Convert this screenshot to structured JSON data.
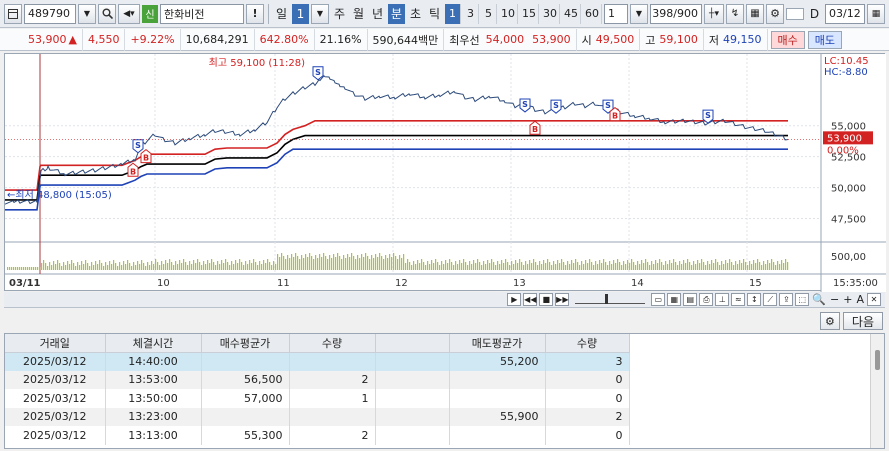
{
  "toolbar": {
    "code": "489790",
    "brand_tag": "신",
    "name": "한화비전",
    "period_day": "일",
    "period_day_num": "1",
    "periods": [
      "주",
      "월",
      "년",
      "분",
      "초",
      "틱"
    ],
    "active_period": "분",
    "minute_options": [
      "1",
      "3",
      "5",
      "10",
      "15",
      "30",
      "45",
      "60"
    ],
    "active_minute": "1",
    "unit_value": "1",
    "count_display": "398/900",
    "d_label": "D",
    "date": "03/12"
  },
  "quote": {
    "price": "53,900",
    "change_arrow": "▲",
    "change": "4,550",
    "change_pct": "+9.22%",
    "volume": "10,684,291",
    "turnover_pct": "642.80%",
    "ratio": "21.16%",
    "amount": "590,644백만",
    "priority_label": "최우선",
    "ask": "54,000",
    "bid": "53,900",
    "open_label": "시",
    "open": "49,500",
    "high_label": "고",
    "high": "59,100",
    "low_label": "저",
    "low": "49,150",
    "buy_label": "매수",
    "sell_label": "매도"
  },
  "chart_data": {
    "type": "line",
    "high_annotation": "최고 59,100 (11:28)",
    "low_annotation": "←최저 48,800 (15:05)",
    "lc_label": "LC:10.45",
    "hc_label": "HC:-8.80",
    "current_price_label": "53,900",
    "current_pct_label": "0.00%",
    "y_ticks": [
      "55,000",
      "52,500",
      "50,000",
      "47,500"
    ],
    "volume_tick": "500,00",
    "x_labels": [
      "03/11",
      "10",
      "11",
      "12",
      "13",
      "14",
      "15"
    ],
    "time_label": "15:35:00",
    "ylim": [
      45600,
      60800
    ],
    "x": [
      0,
      9,
      17,
      25,
      32,
      35,
      36,
      40,
      43,
      60,
      90,
      117,
      130,
      136,
      142,
      150,
      158,
      170,
      185,
      200,
      210,
      222,
      235,
      250,
      262,
      272,
      280,
      288,
      300,
      310,
      315,
      320,
      325,
      330,
      335,
      340,
      348,
      360,
      375,
      390,
      405,
      420,
      435,
      450,
      460,
      470,
      485,
      500,
      510,
      520,
      530,
      540,
      550,
      560,
      570,
      580,
      590,
      600,
      605,
      615,
      630,
      645,
      660,
      680,
      700,
      720,
      740,
      760,
      770,
      783
    ],
    "price": [
      48800,
      48800,
      48900,
      48850,
      48900,
      50800,
      51300,
      51500,
      51600,
      51100,
      51400,
      51900,
      52300,
      53400,
      53800,
      54300,
      53900,
      53600,
      54000,
      54300,
      54600,
      54500,
      54300,
      54700,
      55300,
      56500,
      57200,
      57600,
      58100,
      58400,
      58800,
      59100,
      58900,
      58600,
      58300,
      58100,
      57600,
      57200,
      57400,
      57300,
      57600,
      57300,
      57500,
      57800,
      57300,
      57100,
      57400,
      57000,
      56600,
      56800,
      56300,
      56100,
      56300,
      56500,
      56800,
      56600,
      56800,
      56400,
      56600,
      56100,
      55800,
      55600,
      55300,
      55400,
      55200,
      55400,
      54900,
      54600,
      54300,
      53900
    ],
    "upper_band": [
      49800,
      49800,
      49800,
      49800,
      49800,
      51700,
      51800,
      51800,
      51800,
      51800,
      51800,
      51800,
      52200,
      52500,
      52700,
      52700,
      52700,
      52700,
      52700,
      52700,
      53100,
      53200,
      53200,
      53200,
      53200,
      53600,
      54300,
      54700,
      55000,
      55400,
      55400,
      55400,
      55400,
      55400,
      55400,
      55400,
      55400,
      55400,
      55400,
      55400,
      55400,
      55400,
      55400,
      55400,
      55400,
      55400,
      55400,
      55400,
      55400,
      55400,
      55400,
      55400,
      55400,
      55400,
      55400,
      55400,
      55400,
      55400,
      55400,
      55400,
      55400,
      55400,
      55400,
      55400,
      55400,
      55400,
      55400,
      55400,
      55400,
      55400
    ],
    "mid_band": [
      49000,
      49000,
      49000,
      49000,
      49000,
      50900,
      51000,
      51000,
      51000,
      51000,
      51000,
      51000,
      51400,
      51700,
      51900,
      51900,
      51900,
      51900,
      51900,
      51900,
      52300,
      52400,
      52400,
      52400,
      52400,
      52800,
      53500,
      53900,
      54200,
      54200,
      54200,
      54200,
      54200,
      54200,
      54200,
      54200,
      54200,
      54200,
      54200,
      54200,
      54200,
      54200,
      54200,
      54200,
      54200,
      54200,
      54200,
      54200,
      54200,
      54200,
      54200,
      54200,
      54200,
      54200,
      54200,
      54200,
      54200,
      54200,
      54200,
      54200,
      54200,
      54200,
      54200,
      54200,
      54200,
      54200,
      54200,
      54200,
      54200,
      54200
    ],
    "lower_band": [
      48200,
      48200,
      48200,
      48200,
      48200,
      50100,
      50200,
      50200,
      50200,
      50200,
      50200,
      50200,
      50600,
      50900,
      51100,
      51100,
      51100,
      51100,
      51100,
      51100,
      51500,
      51600,
      51600,
      51600,
      51600,
      52000,
      52700,
      53100,
      53100,
      53100,
      53100,
      53100,
      53100,
      53100,
      53100,
      53100,
      53100,
      53100,
      53100,
      53100,
      53100,
      53100,
      53100,
      53100,
      53100,
      53100,
      53100,
      53100,
      53100,
      53100,
      53100,
      53100,
      53100,
      53100,
      53100,
      53100,
      53100,
      53100,
      53100,
      53100,
      53100,
      53100,
      53100,
      53100,
      53100,
      53100,
      53100,
      53100,
      53100,
      53100
    ],
    "legend": "none",
    "grid": true
  },
  "markers": [
    {
      "type": "S",
      "x": 133,
      "price": 53300
    },
    {
      "type": "B",
      "x": 128,
      "price": 51400
    },
    {
      "type": "B",
      "x": 141,
      "price": 52500
    },
    {
      "type": "S",
      "x": 313,
      "price": 59200
    },
    {
      "type": "S",
      "x": 520,
      "price": 56600
    },
    {
      "type": "S",
      "x": 551,
      "price": 56500
    },
    {
      "type": "B",
      "x": 530,
      "price": 54800
    },
    {
      "type": "S",
      "x": 603,
      "price": 56500
    },
    {
      "type": "B",
      "x": 610,
      "price": 55900
    },
    {
      "type": "S",
      "x": 703,
      "price": 55700
    }
  ],
  "table": {
    "headers": [
      "거래일",
      "체결시간",
      "매수평균가",
      "수량",
      "",
      "매도평균가",
      "수량"
    ],
    "rows": [
      [
        "2025/03/12",
        "14:40:00",
        "",
        "",
        "",
        "55,200",
        "3"
      ],
      [
        "2025/03/12",
        "13:53:00",
        "56,500",
        "2",
        "",
        "",
        "0"
      ],
      [
        "2025/03/12",
        "13:50:00",
        "57,000",
        "1",
        "",
        "",
        "0"
      ],
      [
        "2025/03/12",
        "13:23:00",
        "",
        "",
        "",
        "55,900",
        "2"
      ],
      [
        "2025/03/12",
        "13:13:00",
        "55,300",
        "2",
        "",
        "",
        "0"
      ]
    ]
  },
  "lower": {
    "next_label": "다음"
  },
  "colors": {
    "up": "#d32222",
    "down": "#1f43b6",
    "price_line": "#2c4a7a",
    "volume": "#a9c43b",
    "selected_row": "#cfe8f3"
  }
}
